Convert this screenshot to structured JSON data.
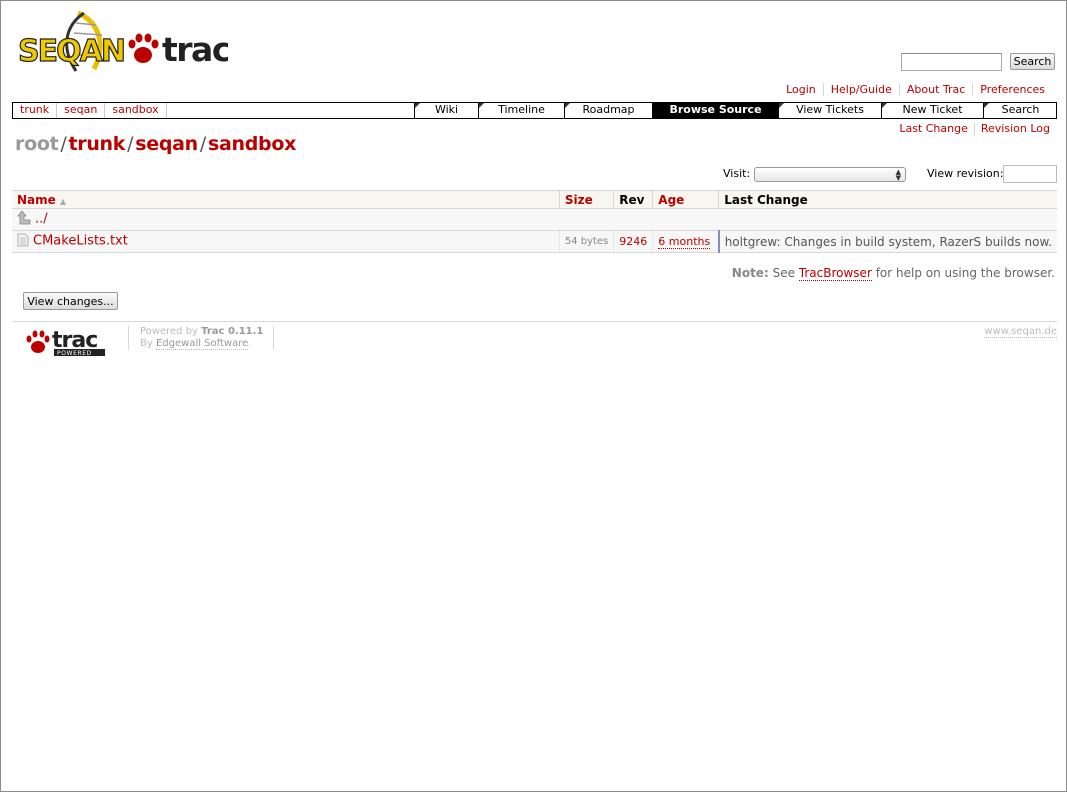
{
  "logo": {
    "project": "SEQAN",
    "product": "trac"
  },
  "search": {
    "button_label": "Search",
    "value": ""
  },
  "metanav": {
    "items": [
      "Login",
      "Help/Guide",
      "About Trac",
      "Preferences"
    ]
  },
  "ctxtpath": {
    "items": [
      "trunk",
      "seqan",
      "sandbox"
    ]
  },
  "mainnav": {
    "tabs": [
      "Wiki",
      "Timeline",
      "Roadmap",
      "Browse Source",
      "View Tickets",
      "New Ticket",
      "Search"
    ],
    "active": "Browse Source"
  },
  "ctxtnav": {
    "items": [
      "Last Change",
      "Revision Log"
    ]
  },
  "breadcrumb": {
    "root": "root",
    "parts": [
      "trunk",
      "seqan",
      "sandbox"
    ],
    "sep": "/"
  },
  "visit": {
    "label": "Visit:",
    "selected": ""
  },
  "revision": {
    "label": "View revision:",
    "value": ""
  },
  "table": {
    "headers": {
      "name": "Name",
      "size": "Size",
      "rev": "Rev",
      "age": "Age",
      "change": "Last Change"
    },
    "sort_indicator": "▲",
    "parent": {
      "name": "../"
    },
    "rows": [
      {
        "name": "CMakeLists.txt",
        "size": "54 bytes",
        "rev": "9246",
        "age": "6 months",
        "change": "holtgrew: Changes in build system, RazerS builds now."
      }
    ]
  },
  "help": {
    "note": "Note:",
    "pre": "See",
    "link": "TracBrowser",
    "post": "for help on using the browser."
  },
  "view_changes": {
    "label": "View changes..."
  },
  "footer": {
    "powered_by": "Powered by",
    "trac_version": "Trac 0.11.1",
    "by": "By",
    "edgewall": "Edgewall Software",
    "site": "www.seqan.de",
    "badge_top": "trac",
    "badge_bottom": "POWERED"
  },
  "colors": {
    "link": "#bb0000",
    "active_tab_bg": "#000000",
    "header_bg": "#f7f7f0"
  }
}
